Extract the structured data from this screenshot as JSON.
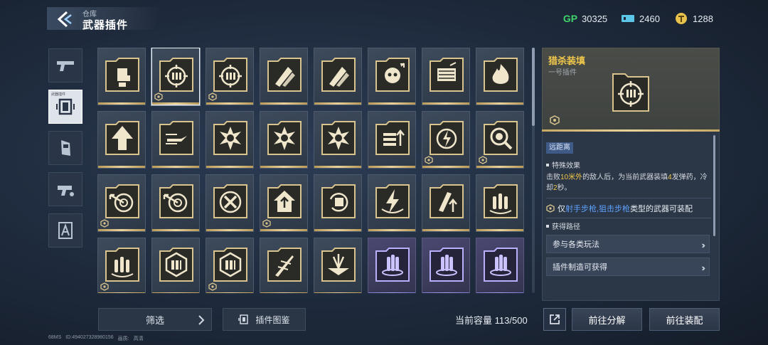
{
  "header": {
    "breadcrumb": "仓库",
    "title": "武器插件"
  },
  "currencies": [
    {
      "icon": "gp-icon",
      "label": "GP",
      "value": "30325"
    },
    {
      "icon": "ticket-icon",
      "label": "",
      "value": "2460"
    },
    {
      "icon": "coin-icon",
      "label": "",
      "value": "1288"
    }
  ],
  "categories": [
    {
      "icon": "pistol-icon",
      "active": false
    },
    {
      "icon": "plugin-icon",
      "active": true,
      "tag": "武器插件"
    },
    {
      "icon": "vehicle-icon",
      "active": false
    },
    {
      "icon": "gadget-icon",
      "active": false
    },
    {
      "icon": "character-icon",
      "active": false
    }
  ],
  "plugins": [
    {
      "icon": "fist-icon",
      "rarity": "gold",
      "badge": false
    },
    {
      "icon": "crosshair-ammo-icon",
      "rarity": "gold",
      "badge": true,
      "selected": true
    },
    {
      "icon": "crosshair-ammo-icon",
      "rarity": "gold",
      "badge": true
    },
    {
      "icon": "bullets-icon",
      "rarity": "gold",
      "badge": false
    },
    {
      "icon": "bullets-icon",
      "rarity": "gold",
      "badge": false
    },
    {
      "icon": "skull-icon",
      "rarity": "gold",
      "badge": false
    },
    {
      "icon": "magazine-icon",
      "rarity": "gold",
      "badge": false
    },
    {
      "icon": "flame-icon",
      "rarity": "gold",
      "badge": false
    },
    {
      "icon": "arrow-up-icon",
      "rarity": "gold",
      "badge": false
    },
    {
      "icon": "speed-bullet-icon",
      "rarity": "gold",
      "badge": false
    },
    {
      "icon": "explosion-icon",
      "rarity": "gold",
      "badge": false
    },
    {
      "icon": "explosion-icon",
      "rarity": "gold",
      "badge": false
    },
    {
      "icon": "explosion-icon",
      "rarity": "gold",
      "badge": false
    },
    {
      "icon": "ammo-up-icon",
      "rarity": "gold",
      "badge": false
    },
    {
      "icon": "lightning-target-icon",
      "rarity": "gold",
      "badge": true
    },
    {
      "icon": "magnify-icon",
      "rarity": "gold",
      "badge": true
    },
    {
      "icon": "target-arrow-icon",
      "rarity": "gold",
      "badge": true
    },
    {
      "icon": "target-arrow-icon",
      "rarity": "gold",
      "badge": false
    },
    {
      "icon": "cross-swords-icon",
      "rarity": "gold",
      "badge": false
    },
    {
      "icon": "house-up-icon",
      "rarity": "gold",
      "badge": true
    },
    {
      "icon": "fist-reload-icon",
      "rarity": "gold",
      "badge": false
    },
    {
      "icon": "lightning-icon",
      "rarity": "gold",
      "badge": false
    },
    {
      "icon": "slash-up-icon",
      "rarity": "gold",
      "badge": false
    },
    {
      "icon": "ammo-stack-icon",
      "rarity": "gold",
      "badge": false
    },
    {
      "icon": "ammo-stack-icon",
      "rarity": "gold",
      "badge": true
    },
    {
      "icon": "ammo-box-icon",
      "rarity": "gold",
      "badge": false
    },
    {
      "icon": "ammo-box-icon",
      "rarity": "gold",
      "badge": true
    },
    {
      "icon": "dart-icon",
      "rarity": "gold",
      "badge": false
    },
    {
      "icon": "cluster-icon",
      "rarity": "gold",
      "badge": false
    },
    {
      "icon": "energy-ammo-icon",
      "rarity": "purple",
      "badge": false
    },
    {
      "icon": "energy-ammo-icon",
      "rarity": "purple",
      "badge": false
    },
    {
      "icon": "energy-ammo-icon",
      "rarity": "purple",
      "badge": false
    }
  ],
  "detail": {
    "name": "猎杀装填",
    "slot": "一号插件",
    "range_tag": "远距离",
    "effect_title": "特殊效果",
    "effect_parts": [
      "击败",
      "10米外",
      "的敌人后，为当前武器装填",
      "4",
      "发弹药，冷却",
      "2",
      "秒。"
    ],
    "equip_prefix": "仅",
    "equip_weapons": "射手步枪,狙击步枪",
    "equip_suffix": "类型的武器可装配",
    "acquire_title": "获得路径",
    "acquire_paths": [
      "参与各类玩法",
      "插件制造可获得"
    ]
  },
  "bottom": {
    "filter_label": "筛选",
    "atlas_label": "插件图鉴",
    "capacity_label": "当前容量",
    "capacity_value": "113/500",
    "decompose_label": "前往分解",
    "equip_label": "前往装配"
  },
  "footer": {
    "fps": "68MS",
    "uid": "ID:494027328980156",
    "quality_label": "画质:",
    "quality_value": "高清"
  },
  "colors": {
    "gold_accent": "#e8d09a",
    "highlight": "#f2c94c",
    "weapon_blue": "#5fa2ff",
    "purple_rarity": "#a8a2ec"
  }
}
